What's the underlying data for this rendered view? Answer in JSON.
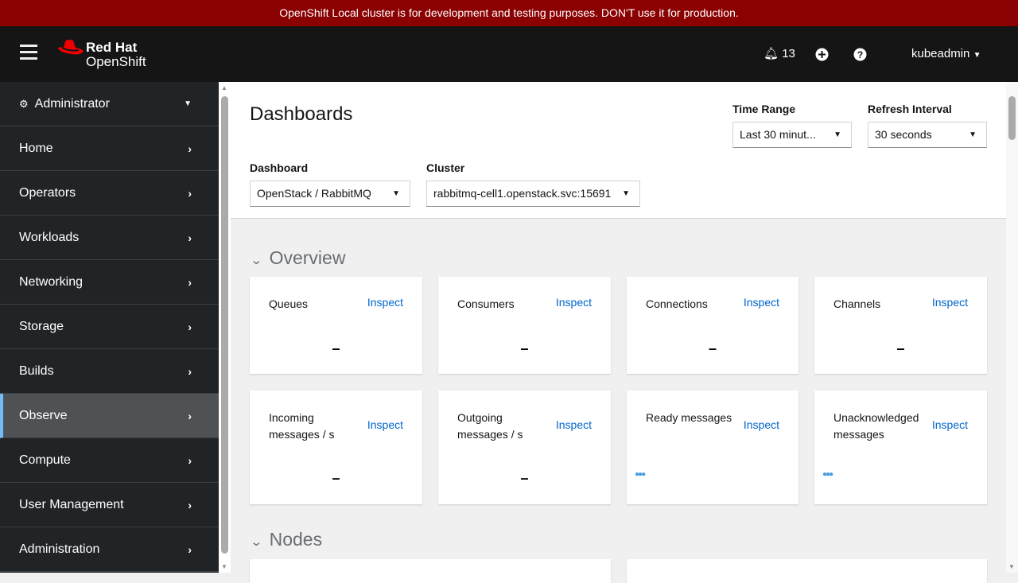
{
  "banner": "OpenShift Local cluster is for development and testing purposes. DON'T use it for production.",
  "brand": {
    "line1": "Red Hat",
    "line2": "OpenShift"
  },
  "header": {
    "notifications": "13",
    "user": "kubeadmin"
  },
  "sidebar": {
    "perspective": "Administrator",
    "items": [
      "Home",
      "Operators",
      "Workloads",
      "Networking",
      "Storage",
      "Builds",
      "Observe",
      "Compute",
      "User Management",
      "Administration"
    ],
    "active": "Observe"
  },
  "page": {
    "title": "Dashboards",
    "time_range": {
      "label": "Time Range",
      "value": "Last 30 minut..."
    },
    "refresh": {
      "label": "Refresh Interval",
      "value": "30 seconds"
    },
    "dashboard": {
      "label": "Dashboard",
      "value": "OpenStack / RabbitMQ"
    },
    "cluster": {
      "label": "Cluster",
      "value": "rabbitmq-cell1.openstack.svc:15691"
    }
  },
  "sections": {
    "overview": "Overview",
    "nodes": "Nodes"
  },
  "inspect": "Inspect",
  "cards": [
    {
      "name": "Queues",
      "value": "–"
    },
    {
      "name": "Consumers",
      "value": "–"
    },
    {
      "name": "Connections",
      "value": "–"
    },
    {
      "name": "Channels",
      "value": "–"
    },
    {
      "name": "Incoming messages / s",
      "value": "–"
    },
    {
      "name": "Outgoing messages / s",
      "value": "–"
    },
    {
      "name": "Ready messages",
      "value": null
    },
    {
      "name": "Unacknowledged messages",
      "value": null
    }
  ]
}
